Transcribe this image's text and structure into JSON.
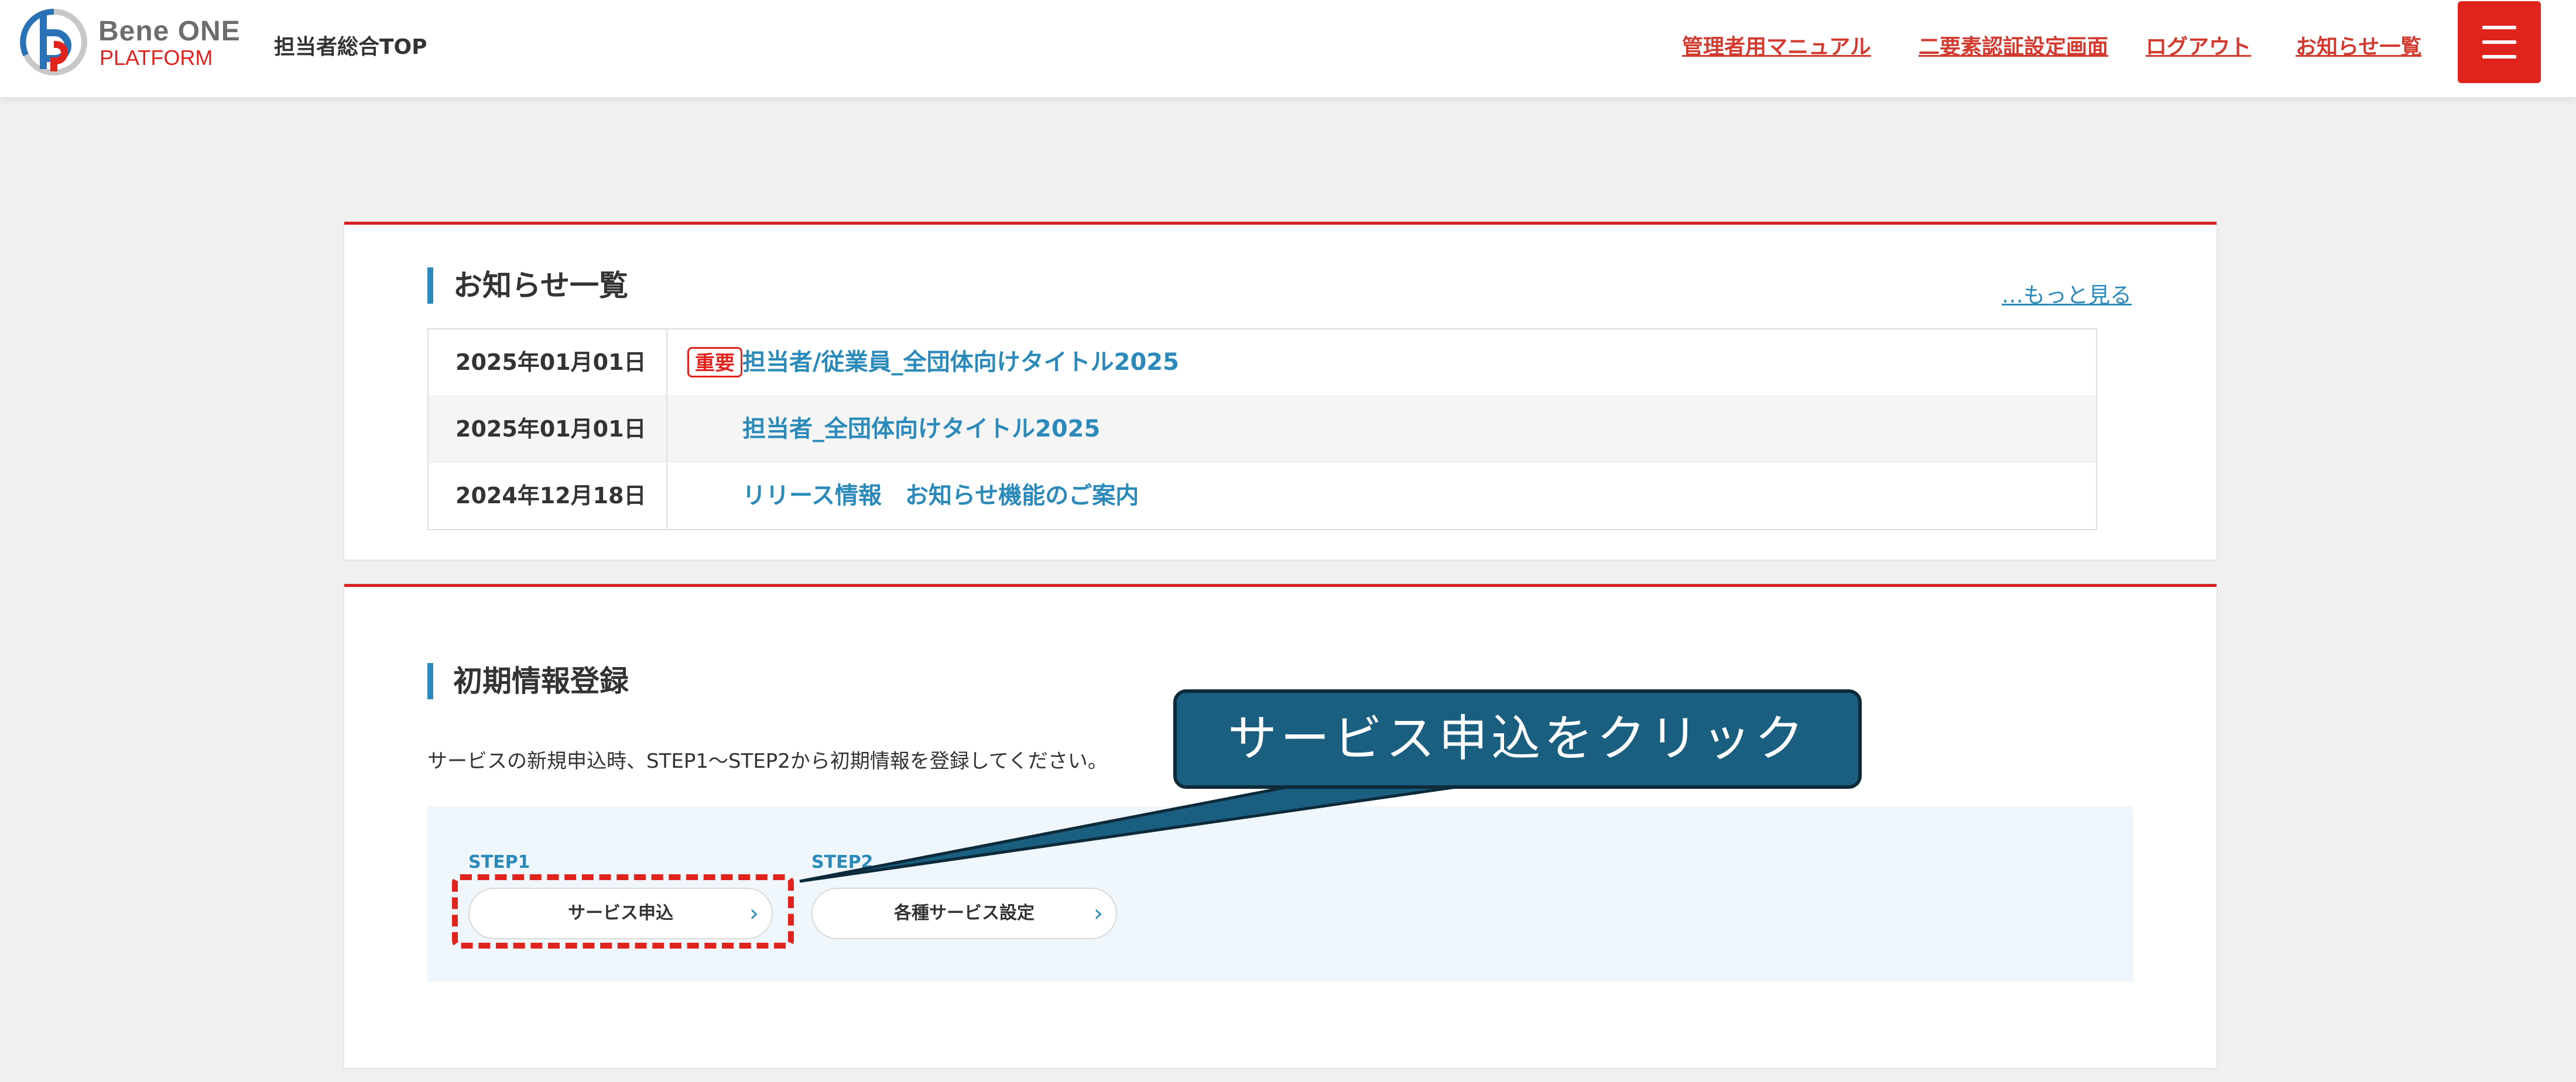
{
  "header": {
    "logo_primary": "Bene ONE",
    "logo_secondary": "PLATFORM",
    "page_title": "担当者総合TOP",
    "nav": [
      {
        "label": "管理者用マニュアル"
      },
      {
        "label": "二要素認証設定画面"
      },
      {
        "label": "ログアウト"
      },
      {
        "label": "お知らせ一覧"
      }
    ],
    "menu_icon": "hamburger-icon"
  },
  "notices": {
    "title": "お知らせ一覧",
    "more_label": "…もっと見る",
    "rows": [
      {
        "date": "2025年01月01日",
        "badge": "重要",
        "title": "担当者/従業員_全団体向けタイトル2025"
      },
      {
        "date": "2025年01月01日",
        "badge": "",
        "title": "担当者_全団体向けタイトル2025"
      },
      {
        "date": "2024年12月18日",
        "badge": "",
        "title": "リリース情報　お知らせ機能のご案内"
      }
    ]
  },
  "initial": {
    "title": "初期情報登録",
    "description": "サービスの新規申込時、STEP1〜STEP2から初期情報を登録してください。",
    "steps": [
      {
        "step_label": "STEP1",
        "button_label": "サービス申込"
      },
      {
        "step_label": "STEP2",
        "button_label": "各種サービス設定"
      }
    ]
  },
  "annotation": {
    "callout_text": "サービス申込をクリック"
  },
  "colors": {
    "accent_red": "#e0231c",
    "link_blue": "#2b8ab9",
    "callout_bg": "#1b5f80"
  }
}
